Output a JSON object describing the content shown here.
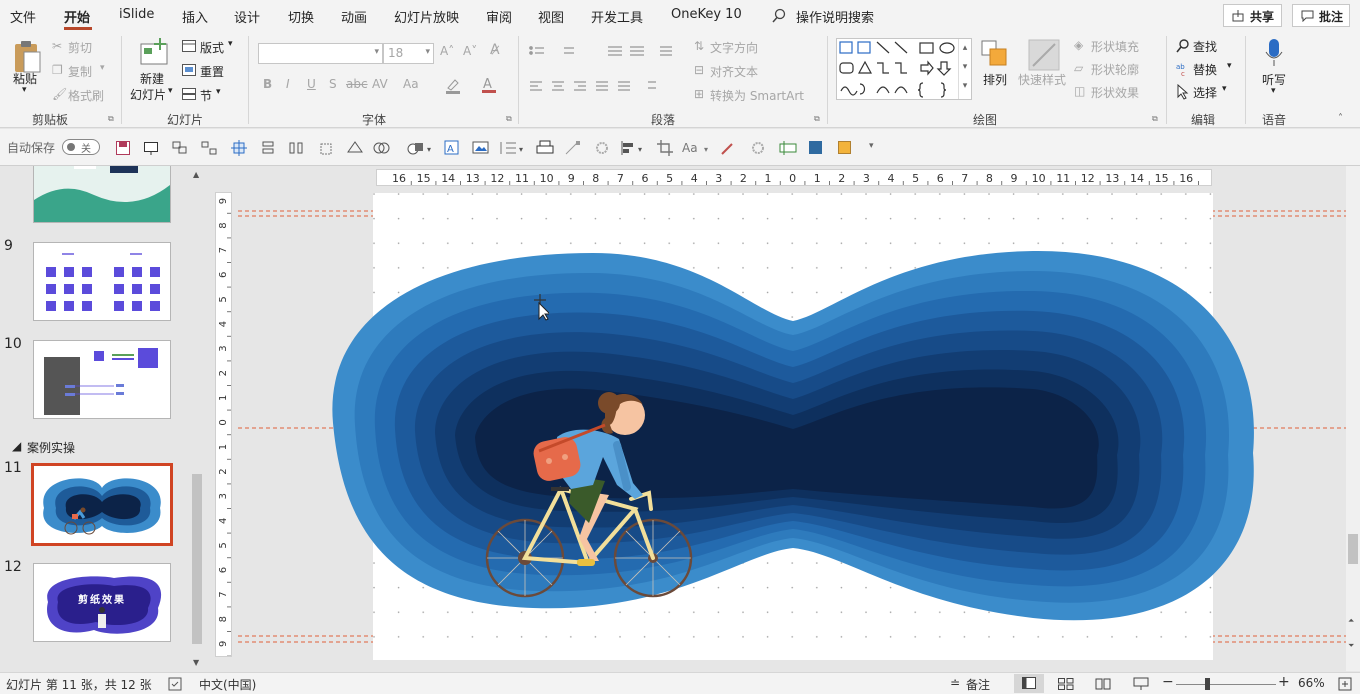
{
  "tabs": [
    "文件",
    "开始",
    "iSlide",
    "插入",
    "设计",
    "切换",
    "动画",
    "幻灯片放映",
    "审阅",
    "视图",
    "开发工具",
    "OneKey 10"
  ],
  "search_label": "操作说明搜索",
  "share_label": "共享",
  "comment_label": "批注",
  "clipboard": {
    "paste": "粘贴",
    "cut": "剪切",
    "copy": "复制",
    "format_painter": "格式刷",
    "group": "剪贴板"
  },
  "slides_group": {
    "new_slide_l1": "新建",
    "new_slide_l2": "幻灯片",
    "layout": "版式",
    "reset": "重置",
    "section": "节",
    "group": "幻灯片"
  },
  "font_group": {
    "size": "18",
    "bold": "B",
    "italic": "I",
    "underline": "U",
    "shadow": "S",
    "strike": "abc",
    "spacing": "AV",
    "case": "Aa",
    "group": "字体"
  },
  "para_group": {
    "text_dir": "文字方向",
    "align_text": "对齐文本",
    "smartart": "转换为 SmartArt",
    "group": "段落"
  },
  "draw_group": {
    "arrange": "排列",
    "quick_styles": "快速样式",
    "fill": "形状填充",
    "outline": "形状轮廓",
    "effects": "形状效果",
    "group": "绘图"
  },
  "edit_group": {
    "find": "查找",
    "replace": "替换",
    "select": "选择",
    "group": "编辑"
  },
  "voice_group": {
    "dictate": "听写",
    "group": "语音"
  },
  "autosave": {
    "label": "自动保存",
    "state": "关"
  },
  "thumbnails": [
    {
      "num": "",
      "partial": true
    },
    {
      "num": "9"
    },
    {
      "num": "10"
    },
    {
      "section": "案例实操"
    },
    {
      "num": "11",
      "selected": true
    },
    {
      "num": "12",
      "title": "剪纸效果"
    }
  ],
  "ruler_h": [
    "16",
    "15",
    "14",
    "13",
    "12",
    "11",
    "10",
    "9",
    "8",
    "7",
    "6",
    "5",
    "4",
    "3",
    "2",
    "1",
    "0",
    "1",
    "2",
    "3",
    "4",
    "5",
    "6",
    "7",
    "8",
    "9",
    "10",
    "11",
    "12",
    "13",
    "14",
    "15",
    "16"
  ],
  "ruler_v": [
    "9",
    "8",
    "7",
    "6",
    "5",
    "4",
    "3",
    "2",
    "1",
    "0",
    "1",
    "2",
    "3",
    "4",
    "5",
    "6",
    "7",
    "8",
    "9"
  ],
  "status": {
    "slide_info": "幻灯片 第 11 张，共 12 张",
    "language": "中文(中国)",
    "notes": "备注",
    "zoom": "66%"
  },
  "colors": {
    "accent": "#b7472a",
    "selection": "#d04423",
    "paper_dark": "#0c2348",
    "paper_light": "#3b8ccb",
    "guide": "#e0603a"
  }
}
